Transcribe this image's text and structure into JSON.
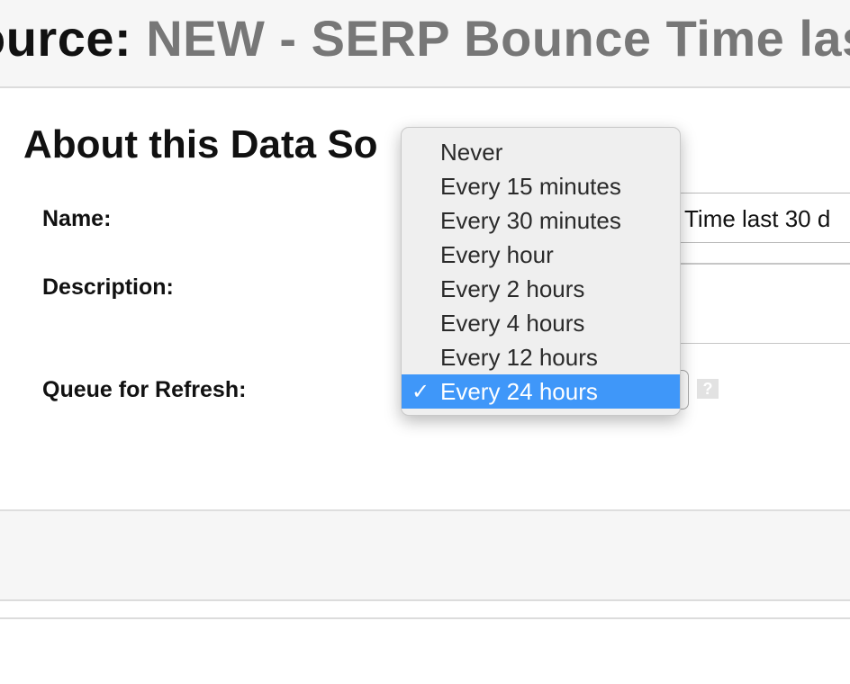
{
  "header": {
    "title_prefix": "ource:",
    "title_name": "NEW - SERP Bounce Time las"
  },
  "section": {
    "title": "About this Data So"
  },
  "form": {
    "name_label": "Name:",
    "name_value": "Time last 30 d",
    "description_label": "Description:",
    "queue_label": "Queue for Refresh:",
    "help_glyph": "?"
  },
  "dropdown": {
    "options": [
      {
        "label": "Never"
      },
      {
        "label": "Every 15 minutes"
      },
      {
        "label": "Every 30 minutes"
      },
      {
        "label": "Every hour"
      },
      {
        "label": "Every 2 hours"
      },
      {
        "label": "Every 4 hours"
      },
      {
        "label": "Every 12 hours"
      },
      {
        "label": "Every 24 hours"
      }
    ],
    "selected_label": "Every 24 hours",
    "check_glyph": "✓"
  },
  "colors": {
    "selection_highlight": "#3f97f9",
    "title_gray": "#777777"
  }
}
